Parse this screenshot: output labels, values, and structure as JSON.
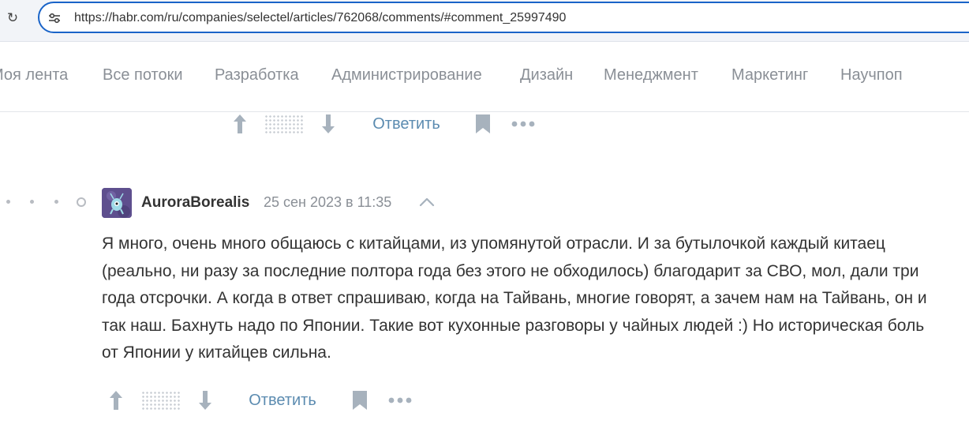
{
  "browser": {
    "url": "https://habr.com/ru/companies/selectel/articles/762068/comments/#comment_25997490",
    "reload_icon": "reload-icon",
    "site_info_icon": "site-info-icon"
  },
  "nav": {
    "items": [
      {
        "label": "Моя лента"
      },
      {
        "label": "Все потоки"
      },
      {
        "label": "Разработка"
      },
      {
        "label": "Администрирование"
      },
      {
        "label": "Дизайн"
      },
      {
        "label": "Менеджмент"
      },
      {
        "label": "Маркетинг"
      },
      {
        "label": "Научпоп"
      }
    ]
  },
  "prev_comment_actions": {
    "reply_label": "Ответить"
  },
  "comment": {
    "author": "AuroraBorealis",
    "timestamp": "25 сен 2023 в 11:35",
    "text": "Я много, очень много общаюсь с китайцами, из упомянутой отрасли. И за бутылочкой каждый китаец (реально, ни разу за последние полтора года без этого не обходилось) благодарит за СВО, мол, дали три года отсрочки. А когда в ответ спрашиваю, когда на Тайвань, многие говорят, а зачем нам на Тайвань, он и так наш. Бахнуть надо по Японии. Такие вот кухонные разговоры у чайных людей :) Но историческая боль от Японии у китайцев сильна.",
    "reply_label": "Ответить"
  },
  "colors": {
    "url_border": "#1a64c8",
    "nav_text": "#8a8f96",
    "reply_link": "#5b8bb0",
    "icon_gray": "#a7b2bd"
  }
}
